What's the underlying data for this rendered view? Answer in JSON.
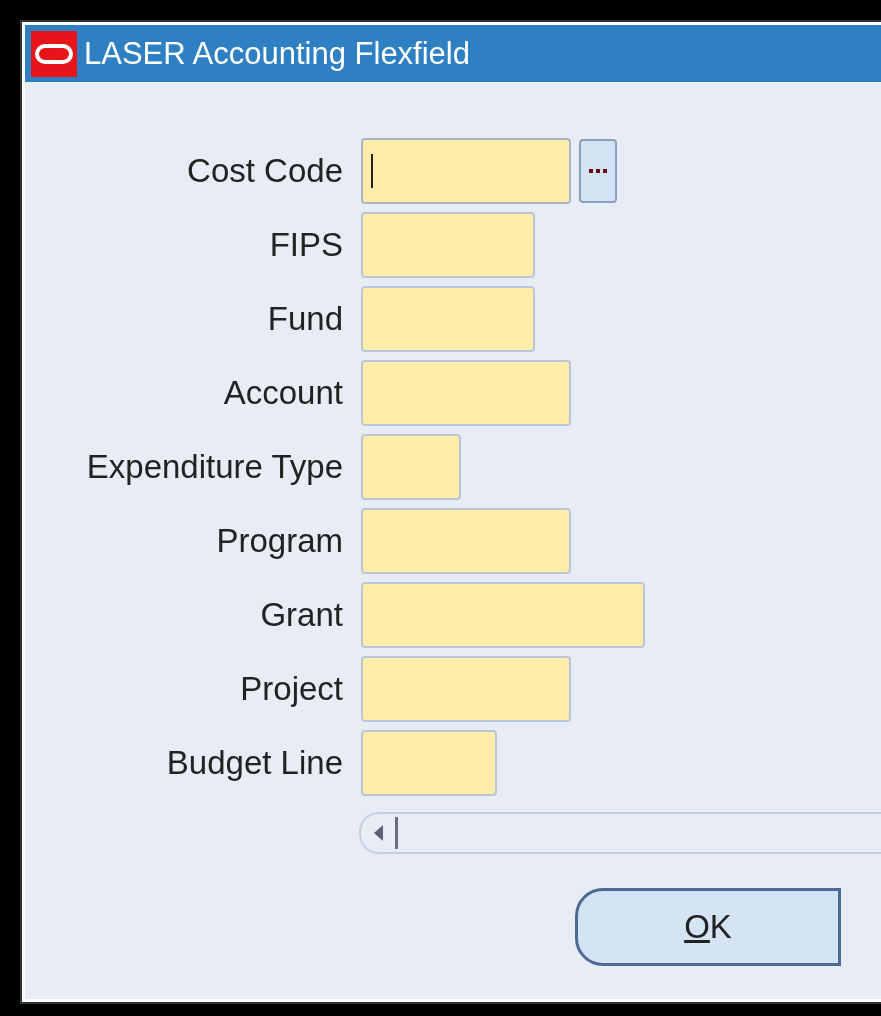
{
  "window": {
    "title": "LASER Accounting Flexfield"
  },
  "fields": [
    {
      "label": "Cost Code",
      "focused": true,
      "has_lov": true
    },
    {
      "label": "FIPS",
      "focused": false,
      "has_lov": false
    },
    {
      "label": "Fund",
      "focused": false,
      "has_lov": false
    },
    {
      "label": "Account",
      "focused": false,
      "has_lov": false
    },
    {
      "label": "Expenditure Type",
      "focused": false,
      "has_lov": false
    },
    {
      "label": "Program",
      "focused": false,
      "has_lov": false
    },
    {
      "label": "Grant",
      "focused": false,
      "has_lov": false
    },
    {
      "label": "Project",
      "focused": false,
      "has_lov": false
    },
    {
      "label": "Budget Line",
      "focused": false,
      "has_lov": false
    }
  ],
  "buttons": [
    {
      "label": "OK"
    }
  ]
}
